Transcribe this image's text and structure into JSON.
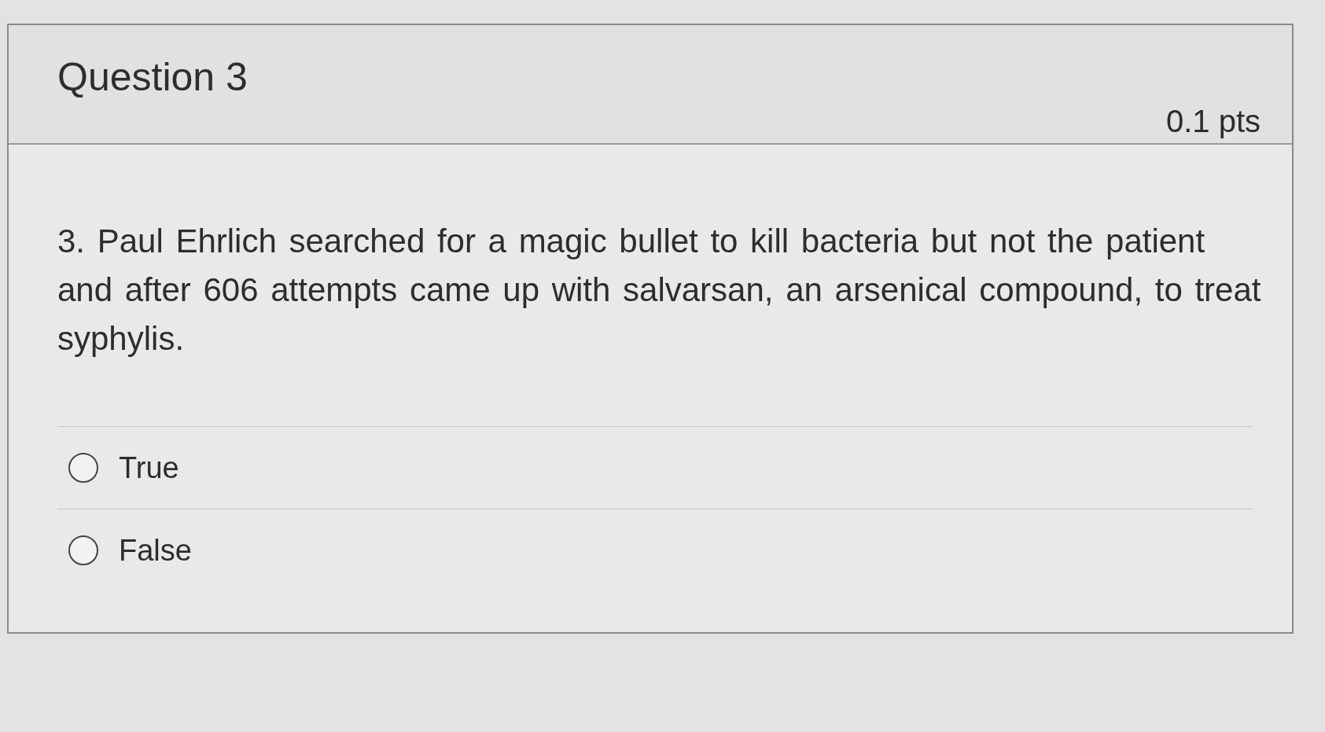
{
  "question": {
    "title": "Question 3",
    "points": "0.1 pts",
    "text": "3. Paul Ehrlich searched for a magic bullet to kill bacteria but not the patient and after 606 attempts came up with salvarsan, an arsenical compound, to treat syphylis.",
    "answers": [
      {
        "label": "True",
        "selected": false
      },
      {
        "label": "False",
        "selected": false
      }
    ]
  }
}
